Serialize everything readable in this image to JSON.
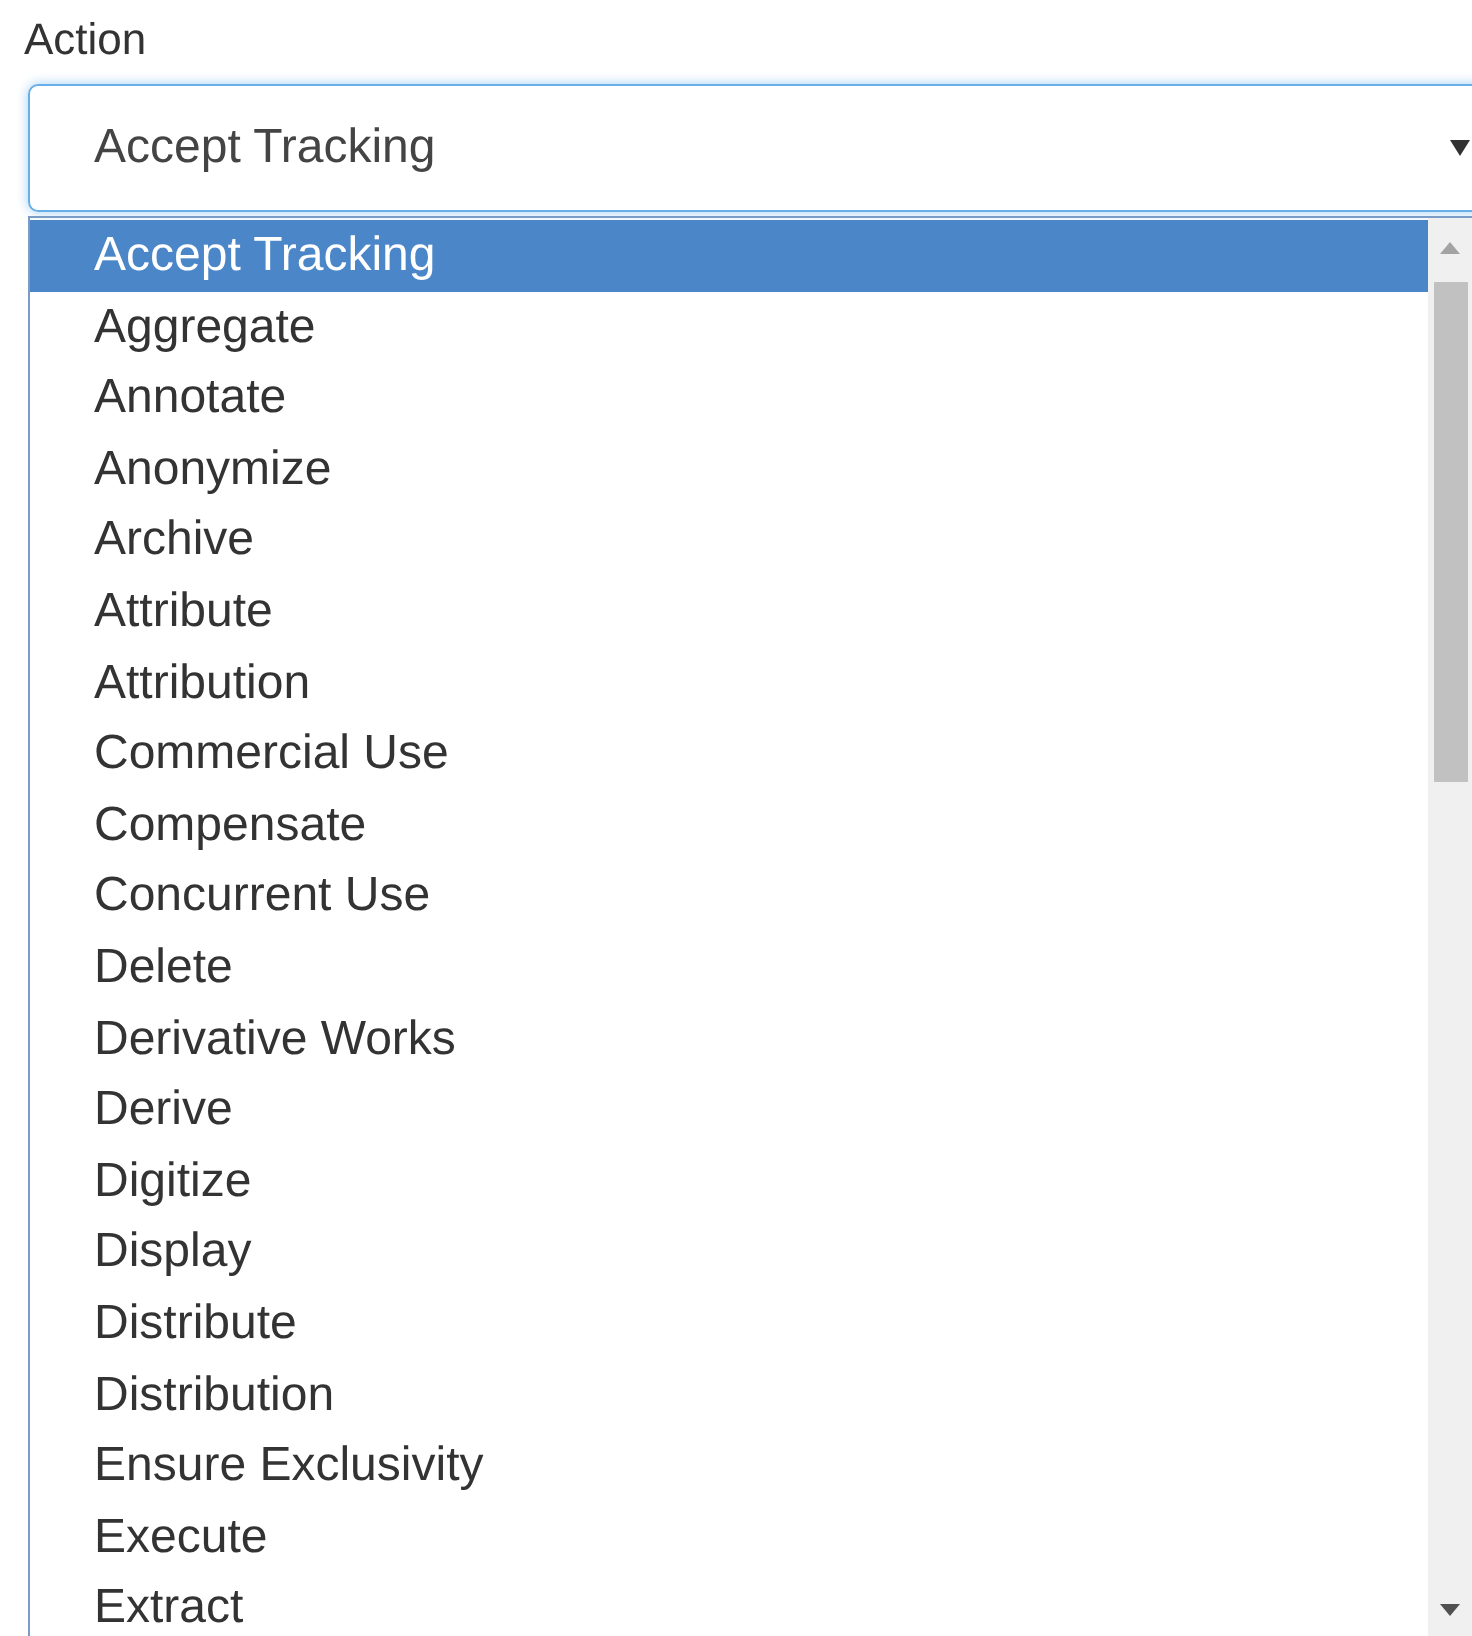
{
  "label": "Action",
  "select": {
    "value": "Accept Tracking",
    "expanded": true
  },
  "options": [
    {
      "label": "Accept Tracking",
      "selected": true
    },
    {
      "label": "Aggregate",
      "selected": false
    },
    {
      "label": "Annotate",
      "selected": false
    },
    {
      "label": "Anonymize",
      "selected": false
    },
    {
      "label": "Archive",
      "selected": false
    },
    {
      "label": "Attribute",
      "selected": false
    },
    {
      "label": "Attribution",
      "selected": false
    },
    {
      "label": "Commercial Use",
      "selected": false
    },
    {
      "label": "Compensate",
      "selected": false
    },
    {
      "label": "Concurrent Use",
      "selected": false
    },
    {
      "label": "Delete",
      "selected": false
    },
    {
      "label": "Derivative Works",
      "selected": false
    },
    {
      "label": "Derive",
      "selected": false
    },
    {
      "label": "Digitize",
      "selected": false
    },
    {
      "label": "Display",
      "selected": false
    },
    {
      "label": "Distribute",
      "selected": false
    },
    {
      "label": "Distribution",
      "selected": false
    },
    {
      "label": "Ensure Exclusivity",
      "selected": false
    },
    {
      "label": "Execute",
      "selected": false
    },
    {
      "label": "Extract",
      "selected": false
    }
  ]
}
